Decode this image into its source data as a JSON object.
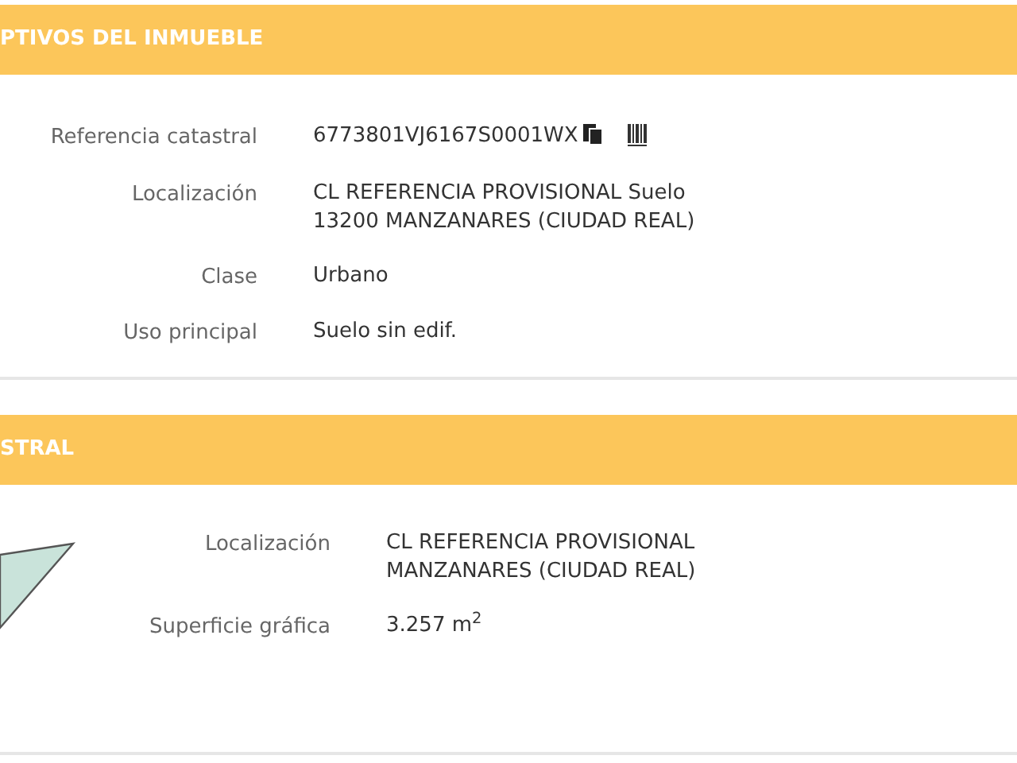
{
  "sections": [
    {
      "title": "PTIVOS DEL INMUEBLE",
      "kind": "details",
      "fields": [
        {
          "label": "Referencia catastral",
          "lines": [
            "6773801VJ6167S0001WX"
          ],
          "kind": "reference"
        },
        {
          "label": "Localización",
          "lines": [
            "CL REFERENCIA PROVISIONAL Suelo",
            "13200 MANZANARES (CIUDAD REAL)"
          ],
          "kind": "text"
        },
        {
          "label": "Clase",
          "lines": [
            "Urbano"
          ],
          "kind": "text"
        },
        {
          "label": "Uso principal",
          "lines": [
            "Suelo sin edif."
          ],
          "kind": "text"
        }
      ]
    },
    {
      "title": "STRAL",
      "kind": "parcel",
      "fields": [
        {
          "label": "Localización",
          "lines": [
            "CL REFERENCIA PROVISIONAL",
            "MANZANARES (CIUDAD REAL)"
          ],
          "kind": "text"
        },
        {
          "label": "Superficie gráfica",
          "lines": [
            "3.257 m$^{2}$"
          ],
          "kind": "text"
        }
      ]
    }
  ]
}
